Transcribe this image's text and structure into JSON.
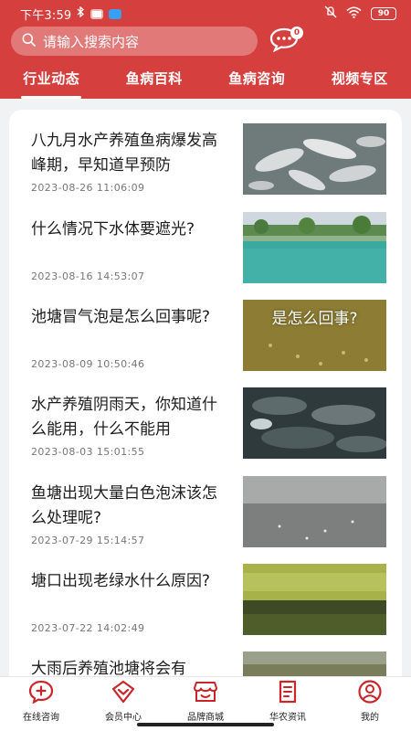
{
  "status_bar": {
    "time": "下午3:59",
    "battery": "90",
    "left_icons": [
      "bluetooth-icon",
      "app-badge-icon",
      "chat-badge-icon"
    ],
    "right_icons": [
      "mute-icon",
      "wifi-icon",
      "battery-icon"
    ]
  },
  "search": {
    "placeholder": "请输入搜索内容",
    "message_count": "0"
  },
  "tabs": [
    {
      "label": "行业动态",
      "active": true
    },
    {
      "label": "鱼病百科",
      "active": false
    },
    {
      "label": "鱼病咨询",
      "active": false
    },
    {
      "label": "视频专区",
      "active": false
    }
  ],
  "articles": [
    {
      "title": "八九月水产养殖鱼病爆发高峰期，早知道早预防",
      "date": "2023-08-26 11:06:09",
      "thumb_text": ""
    },
    {
      "title": "什么情况下水体要遮光?",
      "date": "2023-08-16 14:53:07",
      "thumb_text": ""
    },
    {
      "title": "池塘冒气泡是怎么回事呢?",
      "date": "2023-08-09 10:50:46",
      "thumb_text": "是怎么回事?"
    },
    {
      "title": "水产养殖阴雨天，你知道什么能用，什么不能用",
      "date": "2023-08-03 15:01:55",
      "thumb_text": ""
    },
    {
      "title": "鱼塘出现大量白色泡沫该怎么处理呢?",
      "date": "2023-07-29 15:14:57",
      "thumb_text": ""
    },
    {
      "title": "塘口出现老绿水什么原因?",
      "date": "2023-07-22 14:02:49",
      "thumb_text": ""
    },
    {
      "title": "大雨后养殖池塘将会有",
      "date": "",
      "thumb_text": ""
    }
  ],
  "bottom_nav": [
    {
      "label": "在线咨询",
      "icon": "chat-plus-icon"
    },
    {
      "label": "会员中心",
      "icon": "member-diamond-icon"
    },
    {
      "label": "品牌商城",
      "icon": "store-icon"
    },
    {
      "label": "华农资讯",
      "icon": "news-doc-icon"
    },
    {
      "label": "我的",
      "icon": "user-icon"
    }
  ],
  "colors": {
    "brand": "#d5403f",
    "nav_icon": "#c9262b"
  }
}
